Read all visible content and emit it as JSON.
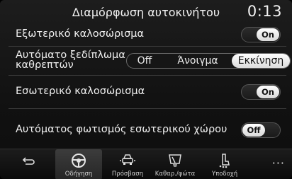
{
  "header": {
    "title": "Διαμόρφωση αυτοκινήτου",
    "clock": "0:13"
  },
  "settings": [
    {
      "label": "Εξωτερικό καλοσώρισμα",
      "toggle_text": "On",
      "state": "on"
    },
    {
      "label_line1": "Αυτόματο ξεδίπλωμα",
      "label_line2": "καθρεπτών",
      "options": [
        "Off",
        "Άνοιγμα",
        "Εκκίνηση"
      ],
      "selected": "Εκκίνηση"
    },
    {
      "label": "Εσωτερικό καλοσώρισμα",
      "toggle_text": "On",
      "state": "on"
    },
    {
      "label": "Αυτόματος φωτισμός εσωτερικού χώρου",
      "toggle_text": "Off",
      "state": "off"
    }
  ],
  "nav": {
    "items": [
      {
        "label": "Οδήγηση",
        "icon": "steering-icon",
        "active": true
      },
      {
        "label": "Πρόσβαση",
        "icon": "car-access-icon",
        "active": false
      },
      {
        "label": "Καθαρ./φώτα",
        "icon": "wiper-lights-icon",
        "active": false
      },
      {
        "label": "Υποδοχή",
        "icon": "seat-welcome-icon",
        "active": false
      }
    ],
    "more": "···"
  },
  "colors": {
    "background": "#111111",
    "toggle_knob": "#ffffff",
    "text": "#f0f0f0"
  }
}
